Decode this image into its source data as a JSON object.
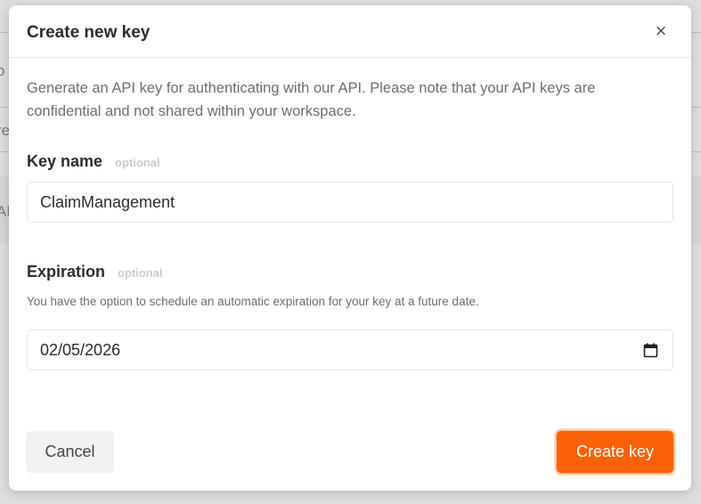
{
  "modal": {
    "title": "Create new key",
    "close_glyph": "×",
    "description": "Generate an API key for authenticating with our API. Please note that your API keys are confidential and not shared within your workspace."
  },
  "key_name": {
    "label": "Key name",
    "optional_tag": "optional",
    "value": "ClaimManagement"
  },
  "expiration": {
    "label": "Expiration",
    "optional_tag": "optional",
    "help_text": "You have the option to schedule an automatic expiration for your key at a future date.",
    "value": "02/05/2026",
    "icon": "calendar-icon"
  },
  "footer": {
    "cancel_label": "Cancel",
    "create_label": "Create key"
  },
  "background": {
    "fragments": [
      "o",
      "re",
      "AF"
    ]
  },
  "colors": {
    "accent": "#fb6207",
    "title_text": "#2d2d2d",
    "muted_text": "#6e6e6e",
    "optional_tag": "#cfc8c4"
  }
}
